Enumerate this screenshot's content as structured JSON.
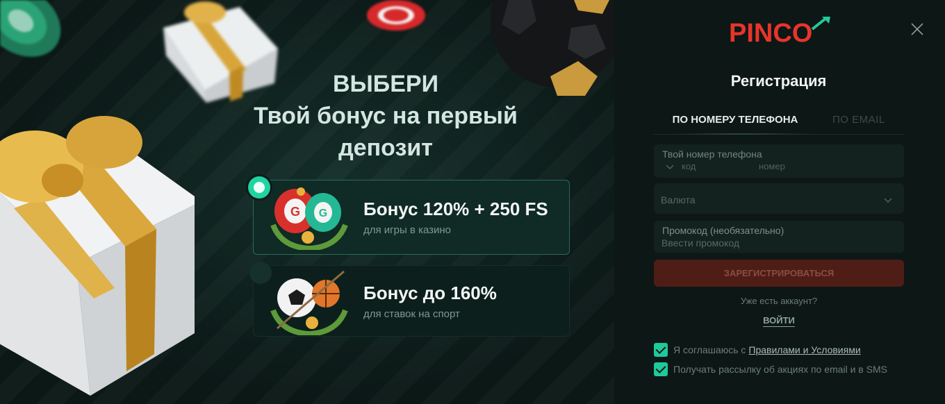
{
  "promo": {
    "title_line1": "ВЫБЕРИ",
    "title_line2": "Твой бонус на первый",
    "title_line3": "депозит",
    "bonuses": [
      {
        "title": "Бонус 120% + 250 FS",
        "subtitle": "для игры в казино",
        "selected": true
      },
      {
        "title": "Бонус до 160%",
        "subtitle": "для ставок на спорт",
        "selected": false
      }
    ]
  },
  "panel": {
    "logo_text": "PINCO",
    "title": "Регистрация",
    "tabs": [
      {
        "label": "ПО НОМЕРУ ТЕЛЕФОНА",
        "active": true
      },
      {
        "label": "ПО EMAIL",
        "active": false
      }
    ],
    "phone": {
      "label": "Твой номер телефона",
      "code_placeholder": "код",
      "number_placeholder": "номер"
    },
    "currency": {
      "placeholder": "Валюта"
    },
    "promocode": {
      "label": "Промокод (необязательно)",
      "placeholder": "Ввести промокод"
    },
    "register_button": "ЗАРЕГИСТРИРОВАТЬСЯ",
    "have_account": "Уже есть аккаунт?",
    "login_link": "ВОЙТИ",
    "agree_text": "Я соглашаюсь с",
    "rules_link": "Правилами и Условиями",
    "newsletter_text": "Получать рассылку об акциях по email и в SMS"
  },
  "colors": {
    "accent": "#1fd3a2",
    "brand_red": "#e8342a",
    "button_disabled": "#4e1d16"
  }
}
